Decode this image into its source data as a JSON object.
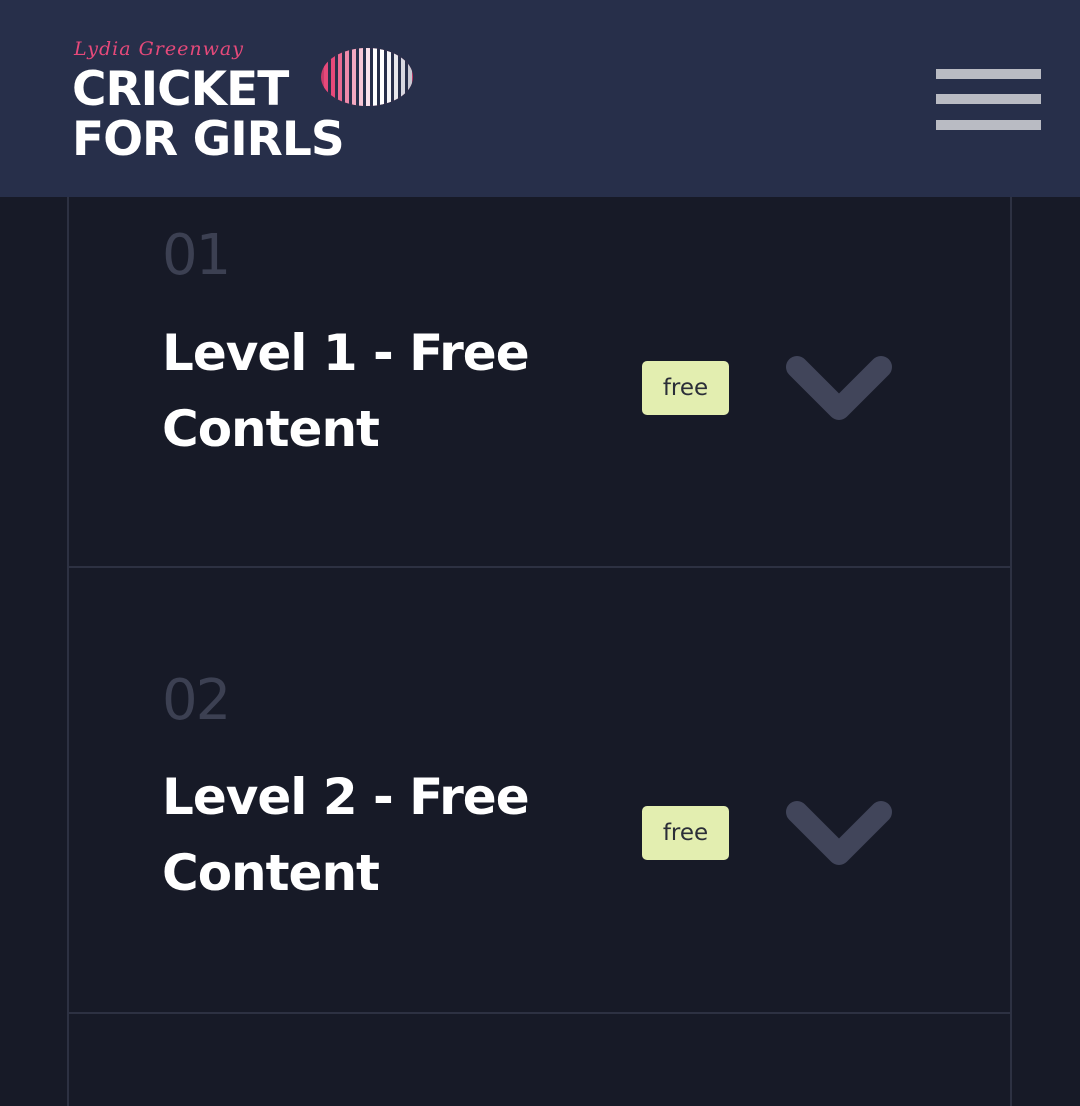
{
  "header": {
    "logo": {
      "script_text": "Lydia Greenway",
      "line1": "CRICKET",
      "line2": "FOR GIRLS",
      "ball_color": "#e6497a"
    },
    "menu_icon": "hamburger-menu-icon"
  },
  "levels": [
    {
      "number": "01",
      "title": "Level 1 - Free Content",
      "badge": "free",
      "expand_icon": "chevron-down-icon"
    },
    {
      "number": "02",
      "title": "Level 2 - Free Content",
      "badge": "free",
      "expand_icon": "chevron-down-icon"
    }
  ],
  "colors": {
    "header_bg": "#272f4a",
    "page_bg": "#171a27",
    "badge_bg": "#e3eeb0",
    "chevron": "#41455a",
    "level_number": "#3c4052",
    "divider": "#2d3142"
  }
}
